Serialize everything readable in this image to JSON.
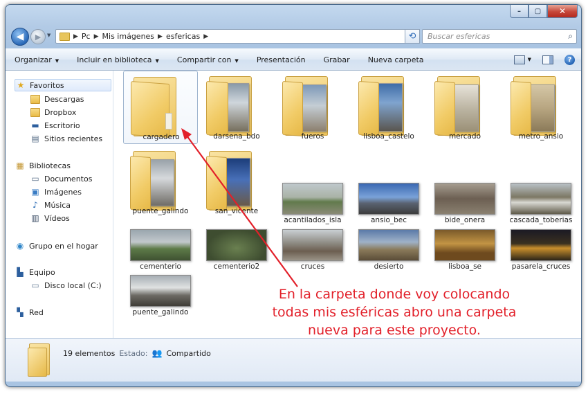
{
  "window": {
    "buttons": {
      "minimize": "–",
      "maximize": "▢",
      "close": "✕"
    }
  },
  "nav": {
    "back": "◀",
    "forward": "▶",
    "breadcrumb": [
      "Pc",
      "Mis imágenes",
      "esfericas"
    ],
    "search_placeholder": "Buscar esfericas"
  },
  "toolbar": {
    "items": [
      "Organizar",
      "Incluir en biblioteca",
      "Compartir con",
      "Presentación",
      "Grabar",
      "Nueva carpeta"
    ]
  },
  "sidebar": {
    "favorites": {
      "label": "Favoritos",
      "items": [
        "Descargas",
        "Dropbox",
        "Escritorio",
        "Sitios recientes"
      ]
    },
    "libraries": {
      "label": "Bibliotecas",
      "items": [
        "Documentos",
        "Imágenes",
        "Música",
        "Vídeos"
      ]
    },
    "homegroup": "Grupo en el hogar",
    "computer": {
      "label": "Equipo",
      "items": [
        "Disco local (C:)"
      ]
    },
    "network": "Red"
  },
  "files": {
    "folders": [
      "cargadero",
      "darsena_bdo",
      "fueros",
      "lisboa_castelo",
      "mercado",
      "metro_ansio",
      "puente_galindo",
      "san_vicente"
    ],
    "images_row1": [
      "acantilados_isla",
      "ansio_bec",
      "bide_onera",
      "cascada_toberias"
    ],
    "images_row2": [
      "cementerio",
      "cementerio2",
      "cruces",
      "desierto",
      "lisboa_se",
      "pasarela_cruces"
    ],
    "images_row3": [
      "puente_galindo"
    ]
  },
  "details": {
    "count": "19 elementos",
    "state_label": "Estado:",
    "state_value": "Compartido"
  },
  "annotation": {
    "lines": [
      "En la carpeta donde voy colocando",
      "todas mis esféricas abro una carpeta",
      "nueva para este proyecto."
    ],
    "color": "#e2202a"
  }
}
